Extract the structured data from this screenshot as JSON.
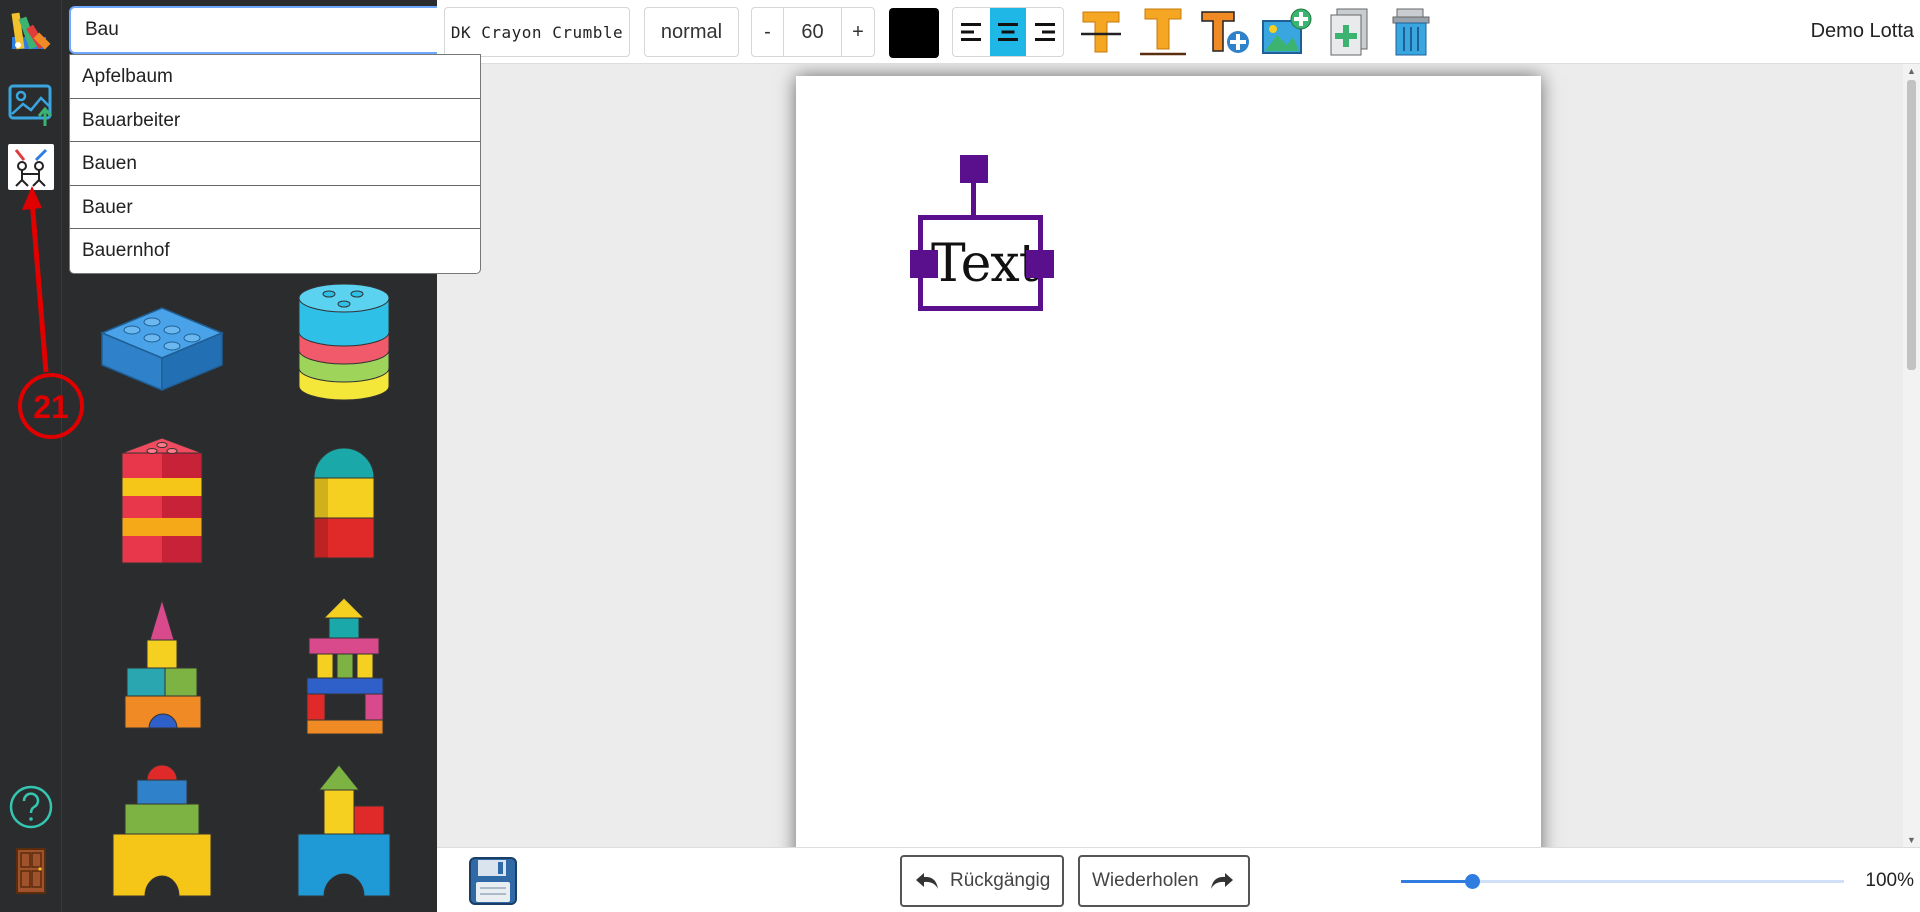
{
  "search": {
    "value": "Bau"
  },
  "suggestions": [
    "Apfelbaum",
    "Bauarbeiter",
    "Bauen",
    "Bauer",
    "Bauernhof"
  ],
  "library_tiles": [
    "brick-icon",
    "stacked-discs-icon",
    "brick-tower-icon",
    "arch-block-icon",
    "castle-tower-icon",
    "block-house-icon",
    "pyramid-arch-icon",
    "gate-tower-icon"
  ],
  "toolbar": {
    "font": "DK Crayon Crumble",
    "weight": "normal",
    "size_minus": "-",
    "size_value": "60",
    "size_plus": "+",
    "text_color": "#000000"
  },
  "user": {
    "name": "Demo Lotta"
  },
  "canvas": {
    "text": "Text",
    "selection_color": "#5a0f8c"
  },
  "history": {
    "undo": "Rückgängig",
    "redo": "Wiederholen"
  },
  "zoom": {
    "label": "100%",
    "fraction": 0.16
  },
  "annotation": {
    "number": "21"
  },
  "collapse": {
    "label": "<"
  }
}
